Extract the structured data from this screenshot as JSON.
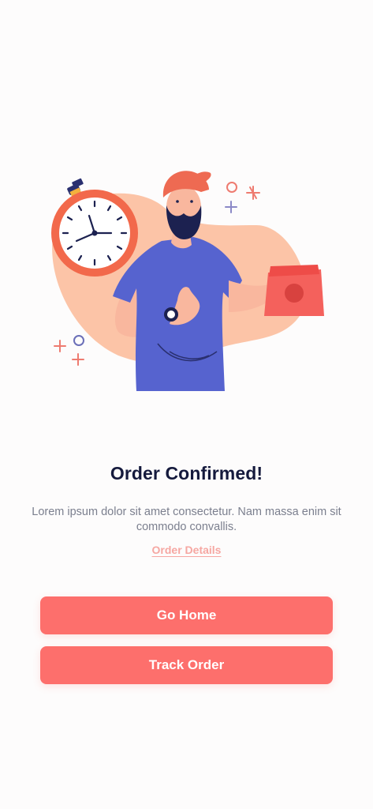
{
  "title": "Order Confirmed!",
  "description": "Lorem ipsum dolor sit amet consectetur. Nam massa enim sit commodo convallis.",
  "order_details_link": "Order Details",
  "buttons": {
    "go_home": "Go Home",
    "track_order": "Track Order"
  },
  "colors": {
    "primary": "#fd6f6c",
    "title": "#151a3d",
    "text_muted": "#7b7f8e",
    "link": "#f6a7a2",
    "background": "#fdfcfc"
  },
  "illustration": {
    "icons": [
      "stopwatch-icon",
      "delivery-man",
      "food-bag-icon",
      "sparkle-decorations"
    ]
  }
}
